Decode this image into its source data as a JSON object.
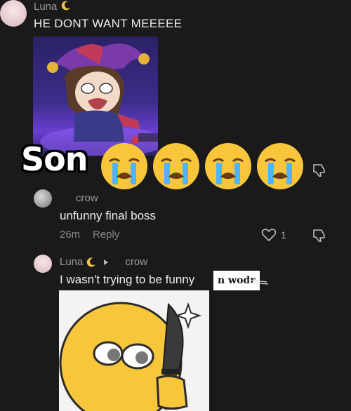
{
  "comment1": {
    "username": "Luna",
    "text": "HE DONT WANT MEEEEE"
  },
  "overlay": {
    "text": "Son"
  },
  "comment2": {
    "username": "crow",
    "text": "unfunny final boss",
    "time": "26m",
    "reply_label": "Reply",
    "like_count": "1"
  },
  "comment3": {
    "username": "Luna",
    "reply_to": "crow",
    "text": "I wasn't trying to be funny",
    "label_box": "n wodr"
  },
  "colors": {
    "background": "#1a1a1a",
    "moon": "#f2c14e",
    "emoji_yellow": "#f8c63a"
  },
  "icons": [
    "moon-icon",
    "reply-arrow-icon",
    "heart-icon",
    "thumbs-down-icon",
    "crying-emoji"
  ]
}
